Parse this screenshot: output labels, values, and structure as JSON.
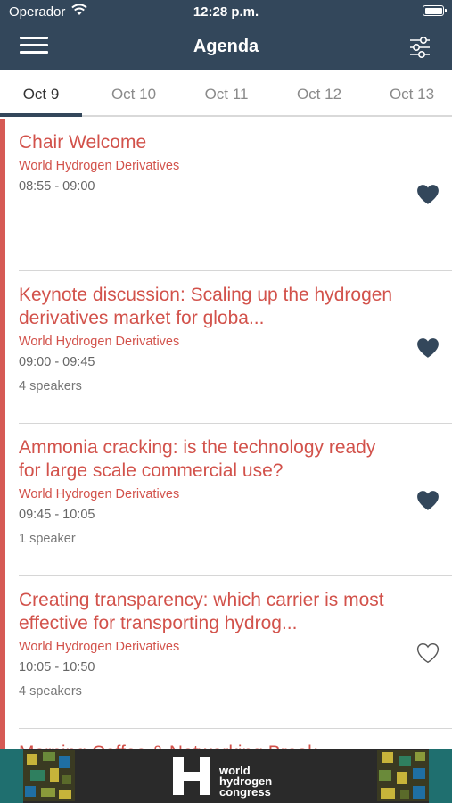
{
  "status_bar": {
    "carrier": "Operador",
    "time": "12:28 p.m."
  },
  "header": {
    "title": "Agenda",
    "menu_icon": "hamburger-icon",
    "filter_icon": "sliders-icon"
  },
  "tabs": [
    {
      "label": "Oct 9",
      "active": true
    },
    {
      "label": "Oct 10",
      "active": false
    },
    {
      "label": "Oct 11",
      "active": false
    },
    {
      "label": "Oct 12",
      "active": false
    },
    {
      "label": "Oct 13",
      "active": false
    }
  ],
  "sessions": [
    {
      "title": "Chair Welcome",
      "track": "World Hydrogen Derivatives",
      "time": "08:55 - 09:00",
      "speakers": "",
      "favorited": true
    },
    {
      "title": "Keynote discussion: Scaling up the hydrogen derivatives market for globa...",
      "track": "World Hydrogen Derivatives",
      "time": "09:00 - 09:45",
      "speakers": "4 speakers",
      "favorited": true
    },
    {
      "title": "Ammonia cracking: is the technology ready for large scale commercial use?",
      "track": "World Hydrogen Derivatives",
      "time": "09:45 - 10:05",
      "speakers": "1 speaker",
      "favorited": true
    },
    {
      "title": "Creating transparency: which carrier is most effective for transporting hydrog...",
      "track": "World Hydrogen Derivatives",
      "time": "10:05 - 10:50",
      "speakers": "4 speakers",
      "favorited": false
    },
    {
      "title": "Morning Coffee & Networking Break",
      "track": "",
      "time": "",
      "speakers": "",
      "favorited": false
    }
  ],
  "banner": {
    "line1": "world",
    "line2": "hydrogen",
    "line3": "congress"
  },
  "colors": {
    "header": "#33475b",
    "accent": "#d65a55",
    "title_red": "#d2524b"
  }
}
